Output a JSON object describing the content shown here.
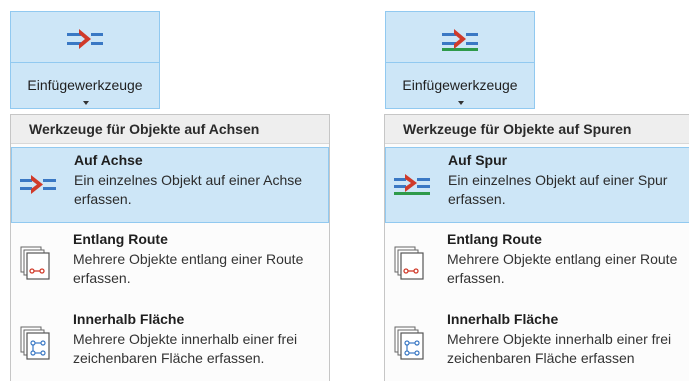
{
  "left": {
    "button": {
      "label": "Einfügewerkzeuge",
      "icon": "point-on-line-icon"
    },
    "menu": {
      "header": "Werkzeuge für Objekte auf Achsen",
      "items": [
        {
          "title": "Auf Achse",
          "description": "Ein einzelnes Objekt auf einer Achse erfassen.",
          "icon": "point-on-line-icon",
          "selected": true
        },
        {
          "title": "Entlang Route",
          "description": "Mehrere Objekte entlang einer Route erfassen.",
          "icon": "along-route-icon",
          "selected": false
        },
        {
          "title": "Innerhalb Fläche",
          "description": "Mehrere Objekte innerhalb einer frei zeichenbaren Fläche erfassen.",
          "icon": "within-area-icon",
          "selected": false
        }
      ]
    }
  },
  "right": {
    "button": {
      "label": "Einfügewerkzeuge",
      "icon": "point-on-track-icon"
    },
    "menu": {
      "header": "Werkzeuge für Objekte auf Spuren",
      "items": [
        {
          "title": "Auf Spur",
          "description": "Ein einzelnes Objekt auf einer Spur erfassen.",
          "icon": "point-on-track-icon",
          "selected": true
        },
        {
          "title": "Entlang Route",
          "description": "Mehrere Objekte entlang einer Route erfassen.",
          "icon": "along-route-icon",
          "selected": false
        },
        {
          "title": "Innerhalb Fläche",
          "description": "Mehrere Objekte innerhalb einer frei zeichenbaren Fläche erfassen",
          "icon": "within-area-icon",
          "selected": false
        }
      ]
    }
  },
  "colors": {
    "accent_blue": "#3a78c4",
    "accent_red": "#d03a2a",
    "track_green": "#2e9a4a",
    "selection_fill": "#cde6f7",
    "selection_border": "#91c9f0"
  }
}
